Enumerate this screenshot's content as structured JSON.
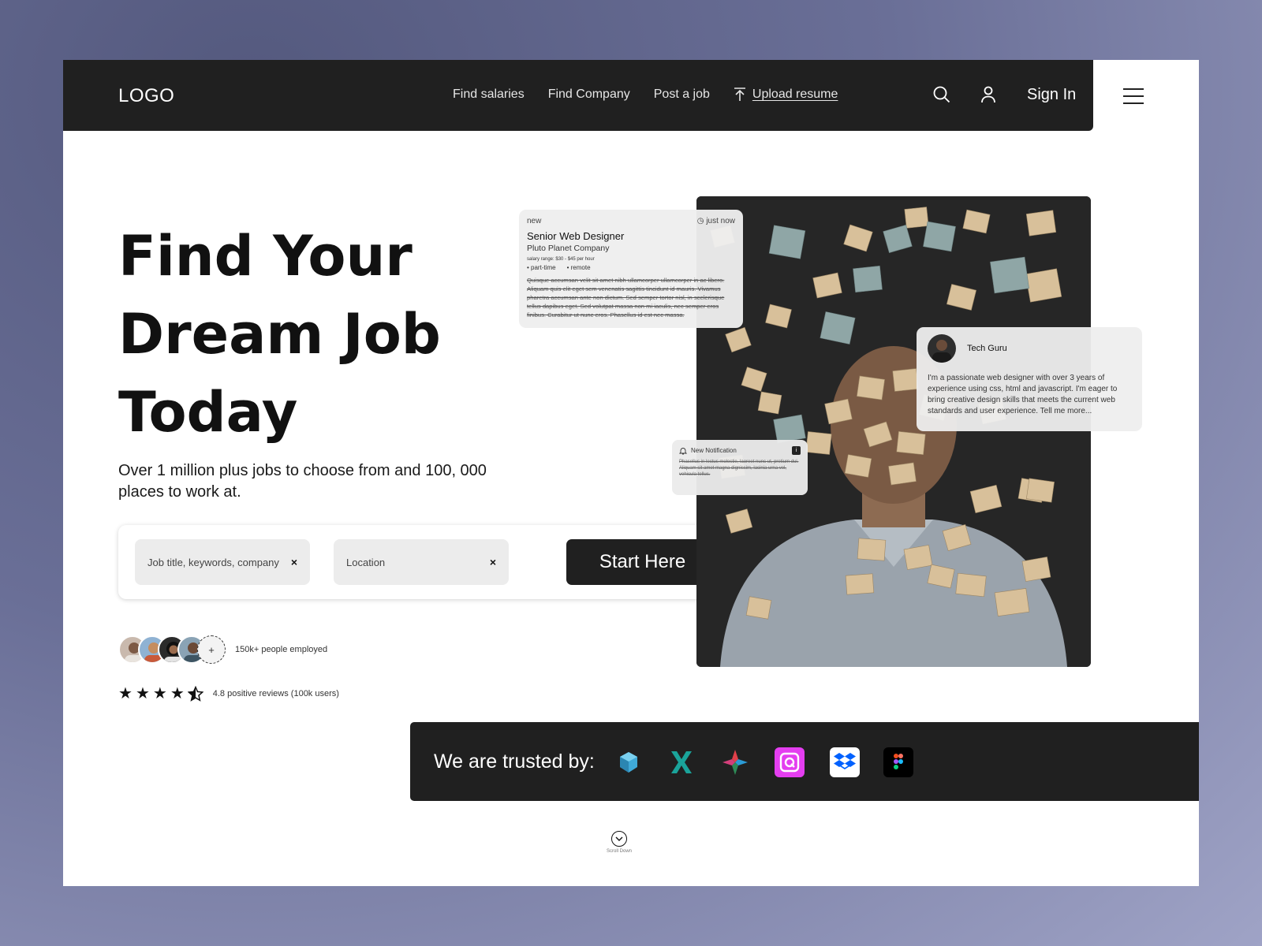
{
  "nav": {
    "logo": "LOGO",
    "links": [
      "Find salaries",
      "Find Company",
      "Post a job"
    ],
    "upload_label": "Upload resume",
    "sign_in": "Sign In",
    "icons": [
      "search-icon",
      "user-icon",
      "upload-icon",
      "menu-icon"
    ]
  },
  "hero": {
    "title_lines": [
      "Find Your",
      "Dream Job",
      "Today"
    ],
    "subtitle": "Over 1 million plus jobs to choose from and 100, 000 places to work at."
  },
  "search": {
    "job_placeholder": "Job title, keywords, company",
    "location_placeholder": "Location",
    "clear_symbol": "×",
    "cta": "Start Here"
  },
  "social_proof": {
    "plus_symbol": "+",
    "employed_text": "150k+ people employed",
    "rating": 4.5,
    "reviews_text": "4.8 positive reviews (100k users)"
  },
  "job_card": {
    "badge": "new",
    "time": "just now",
    "title": "Senior Web Designer",
    "company": "Pluto Planet Company",
    "salary": "salary range: $30 - $45 per hour",
    "tags": [
      "part-time",
      "remote"
    ],
    "description": "Quisque accumsan velit sit amet nibh ullamcorper ullamcorper in ac libero. Aliquam quis elit eget sem venenatis sagittis tincidunt id mauris. Vivamus pharetra accumsan ante non dictum. Sed semper tortor nisl, in scelerisque tellus dapibus eget. Sed volutpat massa non mi iaculis, nec semper eros finibus. Curabitur ut nunc eros. Phasellus id est nec massa."
  },
  "profile_card": {
    "name": "Tech Guru",
    "bio": "I'm a passionate web designer with over 3 years of experience using css, html and javascript. I'm eager to bring creative design skills that meets the current web standards and user experience. Tell me more..."
  },
  "notification": {
    "title": "New Notification",
    "badge": "i",
    "text": "Phasellus in lectus molestie, laoreet nunc ut, pretium dui. Aliquam sit amet magna dignissim, lacinia urna vel, vehicula tellus."
  },
  "trusted": {
    "label": "We are trusted by:",
    "brands": [
      "cube-logo",
      "x-logo",
      "star-logo",
      "quora-logo",
      "dropbox-logo",
      "figma-logo"
    ]
  },
  "scroll": {
    "label": "Scroll Down"
  },
  "colors": {
    "dark": "#202020",
    "accent_pink": "#e43ef0",
    "dropbox_blue": "#0061fe"
  }
}
